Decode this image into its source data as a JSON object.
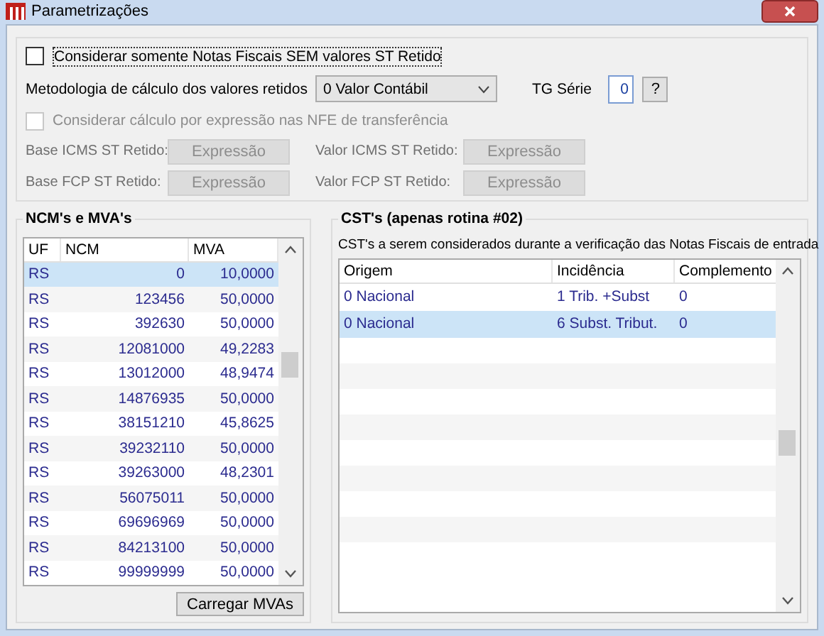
{
  "window": {
    "title": "Parametrizações"
  },
  "options": {
    "only_without_st": {
      "label": "Considerar somente Notas Fiscais SEM valores ST Retido",
      "checked": false,
      "disabled": false
    },
    "methodology": {
      "label": "Metodologia de cálculo dos valores retidos",
      "value": "0 Valor Contábil"
    },
    "tg_serie": {
      "label": "TG Série",
      "value": "0",
      "help": "?"
    },
    "by_expression": {
      "label": "Considerar cálculo por expressão nas NFE de transferência",
      "checked": false,
      "disabled": true
    },
    "expressions": [
      {
        "label": "Base ICMS ST Retido:",
        "button": "Expressão",
        "disabled": true
      },
      {
        "label": "Valor ICMS ST Retido:",
        "button": "Expressão",
        "disabled": true
      },
      {
        "label": "Base FCP ST Retido:",
        "button": "Expressão",
        "disabled": true
      },
      {
        "label": "Valor FCP ST Retido:",
        "button": "Expressão",
        "disabled": true
      }
    ]
  },
  "ncm_group": {
    "title": "NCM's e MVA's",
    "columns": [
      "UF",
      "NCM",
      "MVA"
    ],
    "rows": [
      {
        "uf": "RS",
        "ncm": "0",
        "mva": "10,0000",
        "selected": true
      },
      {
        "uf": "RS",
        "ncm": "123456",
        "mva": "50,0000",
        "selected": false
      },
      {
        "uf": "RS",
        "ncm": "392630",
        "mva": "50,0000",
        "selected": false
      },
      {
        "uf": "RS",
        "ncm": "12081000",
        "mva": "49,2283",
        "selected": false
      },
      {
        "uf": "RS",
        "ncm": "13012000",
        "mva": "48,9474",
        "selected": false
      },
      {
        "uf": "RS",
        "ncm": "14876935",
        "mva": "50,0000",
        "selected": false
      },
      {
        "uf": "RS",
        "ncm": "38151210",
        "mva": "45,8625",
        "selected": false
      },
      {
        "uf": "RS",
        "ncm": "39232110",
        "mva": "50,0000",
        "selected": false
      },
      {
        "uf": "RS",
        "ncm": "39263000",
        "mva": "48,2301",
        "selected": false
      },
      {
        "uf": "RS",
        "ncm": "56075011",
        "mva": "50,0000",
        "selected": false
      },
      {
        "uf": "RS",
        "ncm": "69696969",
        "mva": "50,0000",
        "selected": false
      },
      {
        "uf": "RS",
        "ncm": "84213100",
        "mva": "50,0000",
        "selected": false
      },
      {
        "uf": "RS",
        "ncm": "99999999",
        "mva": "50,0000",
        "selected": false
      }
    ],
    "button": "Carregar MVAs"
  },
  "cst_group": {
    "title": "CST's (apenas rotina #02)",
    "description": "CST's a serem considerados durante a verificação das Notas Fiscais de entrada",
    "columns": [
      "Origem",
      "Incidência",
      "Complemento"
    ],
    "rows": [
      {
        "origem": "0 Nacional",
        "incidencia": "1 Trib. +Subst",
        "complemento": "0",
        "selected": false
      },
      {
        "origem": "0 Nacional",
        "incidencia": "6 Subst. Tribut.",
        "complemento": "0",
        "selected": true
      }
    ]
  }
}
